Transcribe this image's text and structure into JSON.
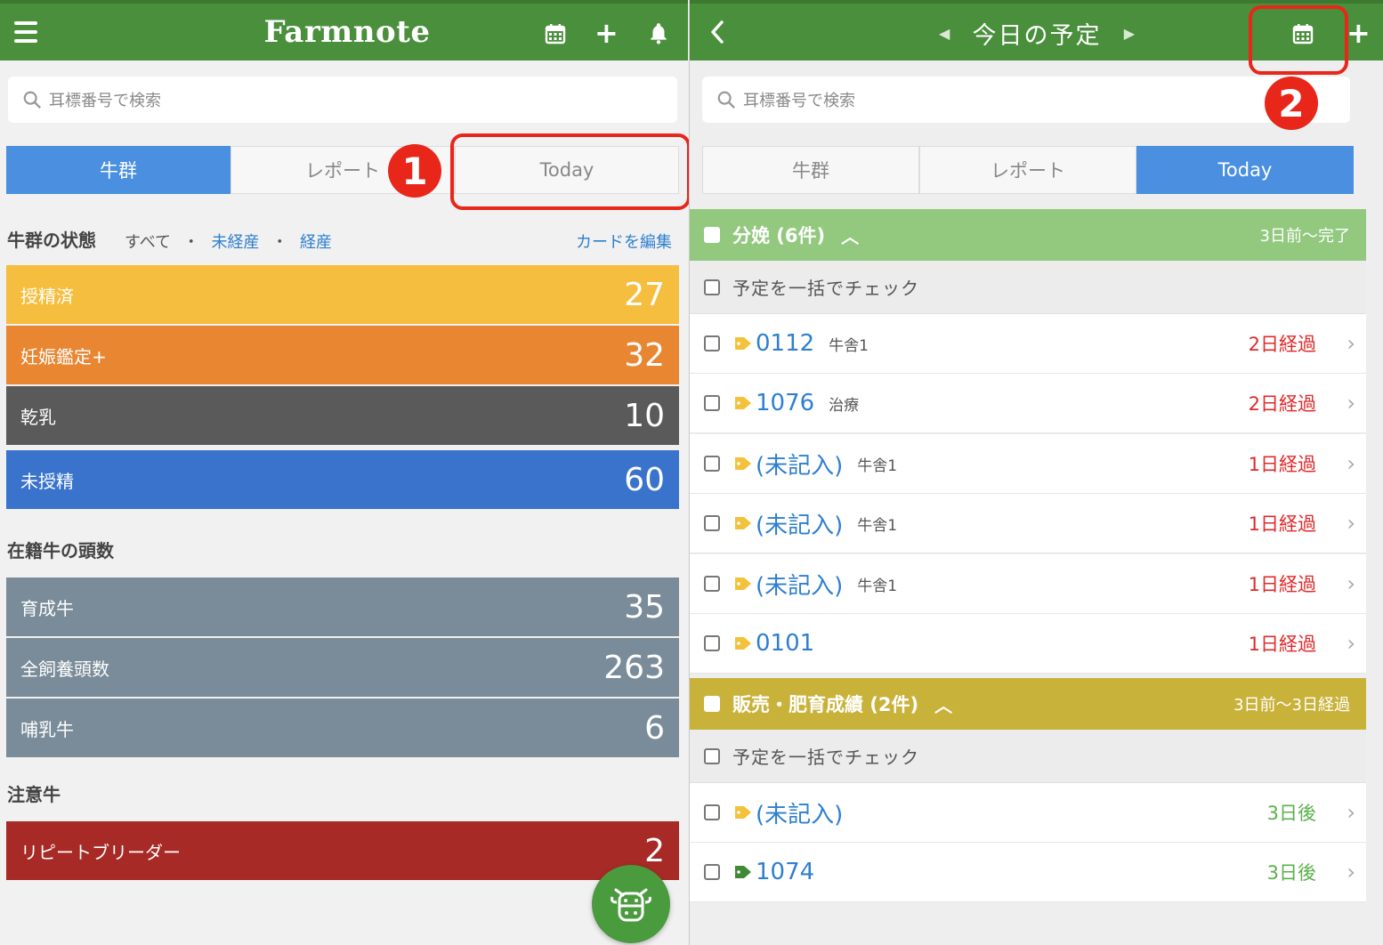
{
  "left": {
    "app_title": "Farmnote",
    "search_placeholder": "耳標番号で検索",
    "tabs": [
      "牛群",
      "レポート",
      "Today"
    ],
    "herd_status": {
      "title": "牛群の状態",
      "filter_all": "すべて",
      "filter_sep": "・",
      "filter_unparous": "未経産",
      "filter_parous": "経産",
      "edit_cards": "カードを編集",
      "cards": [
        {
          "label": "授精済",
          "value": "27",
          "color": "#f5be3e"
        },
        {
          "label": "妊娠鑑定+",
          "value": "32",
          "color": "#e88632"
        },
        {
          "label": "乾乳",
          "value": "10",
          "color": "#5a5a5a"
        },
        {
          "label": "未授精",
          "value": "60",
          "color": "#3a73cc"
        }
      ]
    },
    "headcount": {
      "title": "在籍牛の頭数",
      "cards": [
        {
          "label": "育成牛",
          "value": "35",
          "color": "#7a8c99"
        },
        {
          "label": "全飼養頭数",
          "value": "263",
          "color": "#7a8c99"
        },
        {
          "label": "哺乳牛",
          "value": "6",
          "color": "#7a8c99"
        }
      ]
    },
    "caution": {
      "title": "注意牛",
      "cards": [
        {
          "label": "リピートブリーダー",
          "value": "2",
          "color": "#a72a26"
        }
      ]
    }
  },
  "right": {
    "date_title": "今日の予定",
    "search_placeholder": "耳標番号で検索",
    "tabs": [
      "牛群",
      "レポート",
      "Today"
    ],
    "groups": [
      {
        "title": "分娩 (6件)",
        "range": "3日前〜完了",
        "color": "#92c97e",
        "bulk_label": "予定を一括でチェック",
        "rows": [
          {
            "id": "0112",
            "location": "牛舎1",
            "status": "2日経過",
            "status_color": "red",
            "tag_color": "#f3c23a"
          },
          {
            "id": "1076",
            "location": "治療",
            "status": "2日経過",
            "status_color": "red",
            "tag_color": "#f3c23a"
          },
          {
            "id": "(未記入)",
            "location": "牛舎1",
            "status": "1日経過",
            "status_color": "red",
            "tag_color": "#f3c23a"
          },
          {
            "id": "(未記入)",
            "location": "牛舎1",
            "status": "1日経過",
            "status_color": "red",
            "tag_color": "#f3c23a"
          },
          {
            "id": "(未記入)",
            "location": "牛舎1",
            "status": "1日経過",
            "status_color": "red",
            "tag_color": "#f3c23a"
          },
          {
            "id": "0101",
            "location": "",
            "status": "1日経過",
            "status_color": "red",
            "tag_color": "#f3c23a"
          }
        ]
      },
      {
        "title": "販売・肥育成績 (2件)",
        "range": "3日前〜3日経過",
        "color": "#c9b23a",
        "bulk_label": "予定を一括でチェック",
        "rows": [
          {
            "id": "(未記入)",
            "location": "",
            "status": "3日後",
            "status_color": "green",
            "tag_color": "#f3c23a"
          },
          {
            "id": "1074",
            "location": "",
            "status": "3日後",
            "status_color": "green",
            "tag_color": "#3f8a34"
          }
        ]
      }
    ]
  },
  "callouts": [
    "1",
    "2"
  ]
}
